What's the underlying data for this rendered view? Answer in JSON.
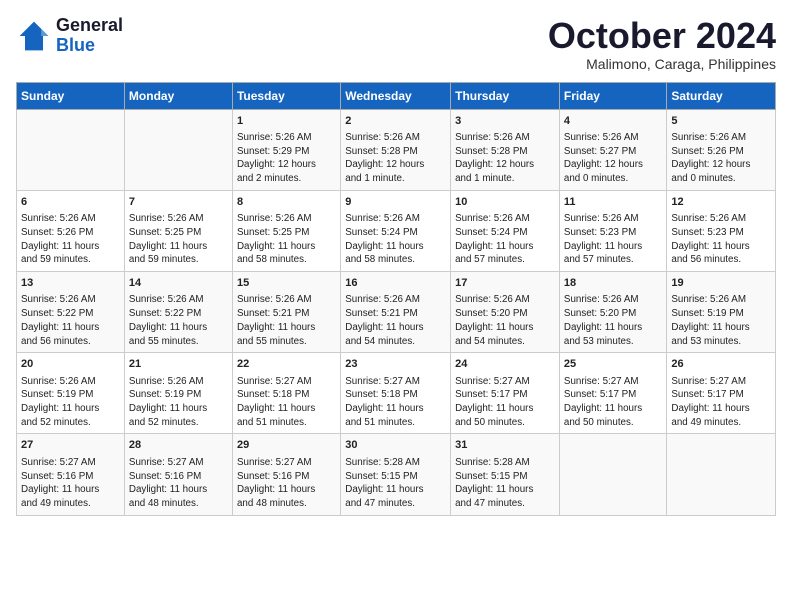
{
  "logo": {
    "line1": "General",
    "line2": "Blue"
  },
  "title": "October 2024",
  "location": "Malimono, Caraga, Philippines",
  "weekdays": [
    "Sunday",
    "Monday",
    "Tuesday",
    "Wednesday",
    "Thursday",
    "Friday",
    "Saturday"
  ],
  "weeks": [
    [
      {
        "day": "",
        "info": ""
      },
      {
        "day": "",
        "info": ""
      },
      {
        "day": "1",
        "info": "Sunrise: 5:26 AM\nSunset: 5:29 PM\nDaylight: 12 hours\nand 2 minutes."
      },
      {
        "day": "2",
        "info": "Sunrise: 5:26 AM\nSunset: 5:28 PM\nDaylight: 12 hours\nand 1 minute."
      },
      {
        "day": "3",
        "info": "Sunrise: 5:26 AM\nSunset: 5:28 PM\nDaylight: 12 hours\nand 1 minute."
      },
      {
        "day": "4",
        "info": "Sunrise: 5:26 AM\nSunset: 5:27 PM\nDaylight: 12 hours\nand 0 minutes."
      },
      {
        "day": "5",
        "info": "Sunrise: 5:26 AM\nSunset: 5:26 PM\nDaylight: 12 hours\nand 0 minutes."
      }
    ],
    [
      {
        "day": "6",
        "info": "Sunrise: 5:26 AM\nSunset: 5:26 PM\nDaylight: 11 hours\nand 59 minutes."
      },
      {
        "day": "7",
        "info": "Sunrise: 5:26 AM\nSunset: 5:25 PM\nDaylight: 11 hours\nand 59 minutes."
      },
      {
        "day": "8",
        "info": "Sunrise: 5:26 AM\nSunset: 5:25 PM\nDaylight: 11 hours\nand 58 minutes."
      },
      {
        "day": "9",
        "info": "Sunrise: 5:26 AM\nSunset: 5:24 PM\nDaylight: 11 hours\nand 58 minutes."
      },
      {
        "day": "10",
        "info": "Sunrise: 5:26 AM\nSunset: 5:24 PM\nDaylight: 11 hours\nand 57 minutes."
      },
      {
        "day": "11",
        "info": "Sunrise: 5:26 AM\nSunset: 5:23 PM\nDaylight: 11 hours\nand 57 minutes."
      },
      {
        "day": "12",
        "info": "Sunrise: 5:26 AM\nSunset: 5:23 PM\nDaylight: 11 hours\nand 56 minutes."
      }
    ],
    [
      {
        "day": "13",
        "info": "Sunrise: 5:26 AM\nSunset: 5:22 PM\nDaylight: 11 hours\nand 56 minutes."
      },
      {
        "day": "14",
        "info": "Sunrise: 5:26 AM\nSunset: 5:22 PM\nDaylight: 11 hours\nand 55 minutes."
      },
      {
        "day": "15",
        "info": "Sunrise: 5:26 AM\nSunset: 5:21 PM\nDaylight: 11 hours\nand 55 minutes."
      },
      {
        "day": "16",
        "info": "Sunrise: 5:26 AM\nSunset: 5:21 PM\nDaylight: 11 hours\nand 54 minutes."
      },
      {
        "day": "17",
        "info": "Sunrise: 5:26 AM\nSunset: 5:20 PM\nDaylight: 11 hours\nand 54 minutes."
      },
      {
        "day": "18",
        "info": "Sunrise: 5:26 AM\nSunset: 5:20 PM\nDaylight: 11 hours\nand 53 minutes."
      },
      {
        "day": "19",
        "info": "Sunrise: 5:26 AM\nSunset: 5:19 PM\nDaylight: 11 hours\nand 53 minutes."
      }
    ],
    [
      {
        "day": "20",
        "info": "Sunrise: 5:26 AM\nSunset: 5:19 PM\nDaylight: 11 hours\nand 52 minutes."
      },
      {
        "day": "21",
        "info": "Sunrise: 5:26 AM\nSunset: 5:19 PM\nDaylight: 11 hours\nand 52 minutes."
      },
      {
        "day": "22",
        "info": "Sunrise: 5:27 AM\nSunset: 5:18 PM\nDaylight: 11 hours\nand 51 minutes."
      },
      {
        "day": "23",
        "info": "Sunrise: 5:27 AM\nSunset: 5:18 PM\nDaylight: 11 hours\nand 51 minutes."
      },
      {
        "day": "24",
        "info": "Sunrise: 5:27 AM\nSunset: 5:17 PM\nDaylight: 11 hours\nand 50 minutes."
      },
      {
        "day": "25",
        "info": "Sunrise: 5:27 AM\nSunset: 5:17 PM\nDaylight: 11 hours\nand 50 minutes."
      },
      {
        "day": "26",
        "info": "Sunrise: 5:27 AM\nSunset: 5:17 PM\nDaylight: 11 hours\nand 49 minutes."
      }
    ],
    [
      {
        "day": "27",
        "info": "Sunrise: 5:27 AM\nSunset: 5:16 PM\nDaylight: 11 hours\nand 49 minutes."
      },
      {
        "day": "28",
        "info": "Sunrise: 5:27 AM\nSunset: 5:16 PM\nDaylight: 11 hours\nand 48 minutes."
      },
      {
        "day": "29",
        "info": "Sunrise: 5:27 AM\nSunset: 5:16 PM\nDaylight: 11 hours\nand 48 minutes."
      },
      {
        "day": "30",
        "info": "Sunrise: 5:28 AM\nSunset: 5:15 PM\nDaylight: 11 hours\nand 47 minutes."
      },
      {
        "day": "31",
        "info": "Sunrise: 5:28 AM\nSunset: 5:15 PM\nDaylight: 11 hours\nand 47 minutes."
      },
      {
        "day": "",
        "info": ""
      },
      {
        "day": "",
        "info": ""
      }
    ]
  ]
}
